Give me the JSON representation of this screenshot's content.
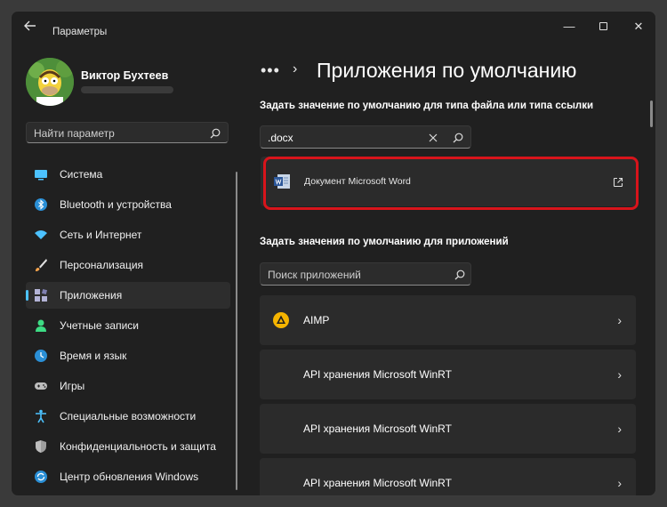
{
  "window": {
    "title": "Параметры",
    "controls": {
      "minimize": "—",
      "close": "✕"
    }
  },
  "profile": {
    "name": "Виктор Бухтеев"
  },
  "sidebar": {
    "search_placeholder": "Найти параметр",
    "items": [
      {
        "label": "Система",
        "icon": "monitor-icon",
        "color": "#4cc2ff"
      },
      {
        "label": "Bluetooth и устройства",
        "icon": "bluetooth-icon",
        "color": "#4cc2ff"
      },
      {
        "label": "Сеть и Интернет",
        "icon": "wifi-icon",
        "color": "#4cc2ff"
      },
      {
        "label": "Персонализация",
        "icon": "brush-icon",
        "color": "#f7a44c"
      },
      {
        "label": "Приложения",
        "icon": "apps-icon",
        "color": "#b3b3d6",
        "active": true
      },
      {
        "label": "Учетные записи",
        "icon": "person-icon",
        "color": "#3ddc84"
      },
      {
        "label": "Время и язык",
        "icon": "globe-clock-icon",
        "color": "#4cc2ff"
      },
      {
        "label": "Игры",
        "icon": "gamepad-icon",
        "color": "#bdbdbd"
      },
      {
        "label": "Специальные возможности",
        "icon": "accessibility-icon",
        "color": "#4cc2ff"
      },
      {
        "label": "Конфиденциальность и защита",
        "icon": "shield-icon",
        "color": "#9e9e9e"
      },
      {
        "label": "Центр обновления Windows",
        "icon": "update-icon",
        "color": "#4cc2ff"
      }
    ]
  },
  "main": {
    "breadcrumb_more": "•••",
    "breadcrumb_sep": "›",
    "title": "Приложения по умолчанию",
    "filetype_heading": "Задать значение по умолчанию для типа файла или типа ссылки",
    "filetype_search": {
      "value": ".docx"
    },
    "file_result": {
      "label": "Документ Microsoft Word"
    },
    "apps_heading": "Задать значения по умолчанию для приложений",
    "apps_search_placeholder": "Поиск приложений",
    "apps": [
      {
        "label": "AIMP",
        "icon": "aimp-icon"
      },
      {
        "label": "API хранения Microsoft WinRT",
        "icon": ""
      },
      {
        "label": "API хранения Microsoft WinRT",
        "icon": ""
      },
      {
        "label": "API хранения Microsoft WinRT",
        "icon": ""
      }
    ],
    "chevron": "›"
  },
  "colors": {
    "accent": "#4cc2ff",
    "highlight": "#d8141b",
    "background": "#202020",
    "card": "#2b2b2b"
  }
}
